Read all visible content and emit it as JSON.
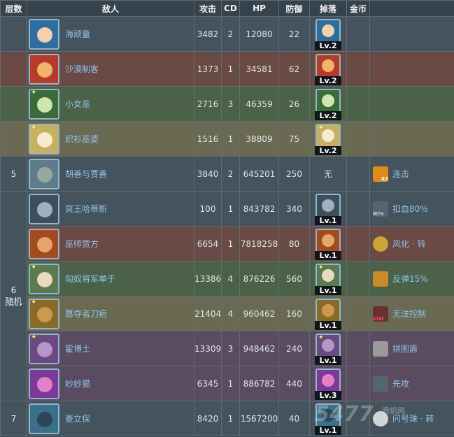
{
  "headers": {
    "layer": "层数",
    "enemy": "敌人",
    "attack": "攻击",
    "cd": "CD",
    "hp": "HP",
    "defense": "防御",
    "drop": "掉落",
    "gold": "金币"
  },
  "rows": [
    {
      "enemy": "海顽童",
      "attack": "3482",
      "cd": "2",
      "hp": "12080",
      "defense": "22",
      "drop_level": "Lv.2",
      "drop_text": "",
      "skill": ""
    },
    {
      "enemy": "沙漠制客",
      "attack": "1373",
      "cd": "1",
      "hp": "34581",
      "defense": "62",
      "drop_level": "Lv.2",
      "drop_text": "",
      "skill": ""
    },
    {
      "enemy": "小女巫",
      "attack": "2716",
      "cd": "3",
      "hp": "46359",
      "defense": "26",
      "drop_level": "Lv.2",
      "drop_text": "",
      "skill": ""
    },
    {
      "enemy": "织衫巫婆",
      "attack": "1516",
      "cd": "1",
      "hp": "38809",
      "defense": "75",
      "drop_level": "Lv.2",
      "drop_text": "",
      "skill": ""
    },
    {
      "enemy": "胡善与贾善",
      "attack": "3840",
      "cd": "2",
      "hp": "645201",
      "defense": "250",
      "drop_level": "",
      "drop_text": "无",
      "skill": "连击"
    },
    {
      "enemy": "冥王哈蒂斯",
      "attack": "100",
      "cd": "1",
      "hp": "843782",
      "defense": "340",
      "drop_level": "Lv.1",
      "drop_text": "",
      "skill": "扣血80%"
    },
    {
      "enemy": "巫师贾方",
      "attack": "6654",
      "cd": "1",
      "hp": "7818258",
      "defense": "80",
      "drop_level": "Lv.1",
      "drop_text": "",
      "skill": "风化 · 转"
    },
    {
      "enemy": "匈奴将军单于",
      "attack": "13386",
      "cd": "4",
      "hp": "876226",
      "defense": "560",
      "drop_level": "Lv.1",
      "drop_text": "",
      "skill": "反弹15%"
    },
    {
      "enemy": "篡夺者刀疤",
      "attack": "21404",
      "cd": "4",
      "hp": "960462",
      "defense": "160",
      "drop_level": "Lv.1",
      "drop_text": "",
      "skill": "无法控制"
    },
    {
      "enemy": "霍博士",
      "attack": "13309",
      "cd": "3",
      "hp": "948462",
      "defense": "240",
      "drop_level": "Lv.1",
      "drop_text": "",
      "skill": "拼图盾"
    },
    {
      "enemy": "妙妙猫",
      "attack": "6345",
      "cd": "1",
      "hp": "886782",
      "defense": "440",
      "drop_level": "Lv.3",
      "drop_text": "",
      "skill": "先攻"
    },
    {
      "enemy": "查立保",
      "attack": "8420",
      "cd": "1",
      "hp": "1567200",
      "defense": "40",
      "drop_level": "Lv.1",
      "drop_text": "",
      "skill": "问号珠 · 转"
    }
  ],
  "layers": {
    "five": "5",
    "six": "6",
    "six_sub": "随机",
    "seven": "7"
  },
  "skill_badges": {
    "combo": "X2",
    "percent": "80%",
    "stat": "STAT"
  },
  "watermark": {
    "main": "5477",
    "sub": "我机网"
  },
  "colors": {
    "blue": "#45535d",
    "red": "#6a4a44",
    "green": "#4b6248",
    "olive": "#6a6a52",
    "purple": "#5a4b60",
    "link": "#8ec3ec"
  }
}
